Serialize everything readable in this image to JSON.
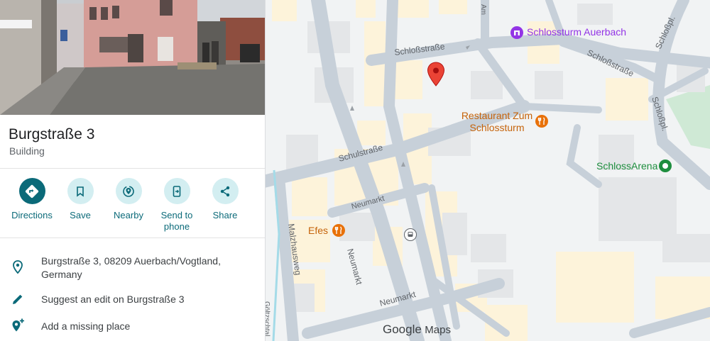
{
  "place": {
    "name": "Burgstraße 3",
    "category": "Building"
  },
  "actions": [
    {
      "label": "Directions",
      "icon": "directions-icon"
    },
    {
      "label": "Save",
      "icon": "bookmark-icon"
    },
    {
      "label": "Nearby",
      "icon": "nearby-icon"
    },
    {
      "label": "Send to phone",
      "icon": "send-to-phone-icon"
    },
    {
      "label": "Share",
      "icon": "share-icon"
    }
  ],
  "info": {
    "address": "Burgstraße 3, 08209 Auerbach/Vogtland, Germany",
    "suggest_edit": "Suggest an edit on Burgstraße 3",
    "add_place": "Add a missing place"
  },
  "map": {
    "pois": {
      "schlossturm": "Schlossturm Auerbach",
      "restaurant": "Restaurant Zum Schlossturm",
      "arena": "SchlossArena",
      "efes": "Efes"
    },
    "streets": {
      "schlossstrasse_top": "Schloßstraße",
      "schlossstrasse_right": "Schloßstraße",
      "schlosspl_top": "Schloßpl.",
      "schlosspl_mid": "Schloßpl.",
      "schulstrasse": "Schulstraße",
      "neumarkt_top": "Neumarkt",
      "neumarkt_vert": "Neumarkt",
      "neumarkt_bottom": "Neumarkt",
      "malzhausweg": "Malzhausweg",
      "goeltzschtal": "Göltzschtal",
      "top_edge": "Am"
    },
    "brand": {
      "google": "Google",
      "maps": "Maps"
    },
    "colors": {
      "accent": "#0b6a79",
      "pin": "#ea4335",
      "restaurant": "#e8710a",
      "park": "#1e8e3e",
      "poi_purple": "#9334e6"
    }
  }
}
